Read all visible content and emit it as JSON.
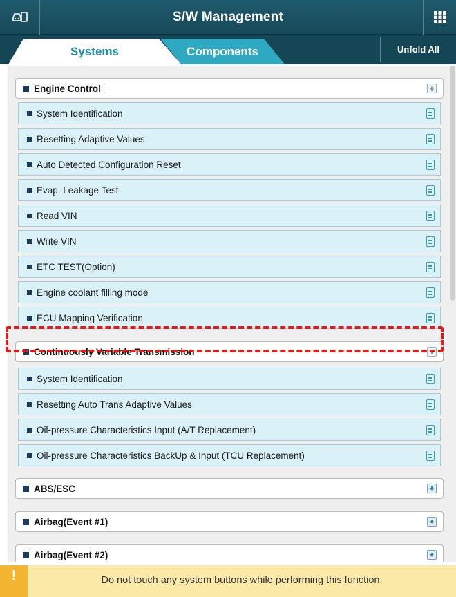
{
  "header": {
    "title": "S/W Management",
    "left_icon": "vehicle-screen-icon",
    "right_icon": "grid-menu-icon"
  },
  "tabs": [
    {
      "label": "Systems",
      "active": true
    },
    {
      "label": "Components",
      "active": false
    }
  ],
  "unfold_all_label": "Unfold All",
  "groups": [
    {
      "title": "Engine Control",
      "expanded": true,
      "items": [
        "System Identification",
        "Resetting Adaptive Values",
        "Auto Detected Configuration Reset",
        "Evap. Leakage Test",
        "Read VIN",
        "Write VIN",
        "ETC TEST(Option)",
        "Engine coolant filling mode",
        "ECU Mapping Verification"
      ]
    },
    {
      "title": "Continuously Variable Transmission",
      "expanded": true,
      "items": [
        "System Identification",
        "Resetting Auto Trans Adaptive Values",
        "Oil-pressure Characteristics Input (A/T Replacement)",
        "Oil-pressure Characteristics BackUp & Input (TCU Replacement)"
      ]
    },
    {
      "title": "ABS/ESC",
      "expanded": false,
      "items": []
    },
    {
      "title": "Airbag(Event #1)",
      "expanded": false,
      "items": []
    },
    {
      "title": "Airbag(Event #2)",
      "expanded": false,
      "items": []
    }
  ],
  "warning": {
    "icon": "!",
    "text": "Do not touch any system buttons while performing this function."
  },
  "colors": {
    "header_bg": "#1b5062",
    "tab_active_text": "#1c8fb0",
    "tab_inactive_bg": "#2ea9c1",
    "item_bg": "#d9f1f7",
    "highlight": "#e01b1b",
    "warning_bg": "#fbe9a8",
    "warning_icon_bg": "#f4b530"
  }
}
